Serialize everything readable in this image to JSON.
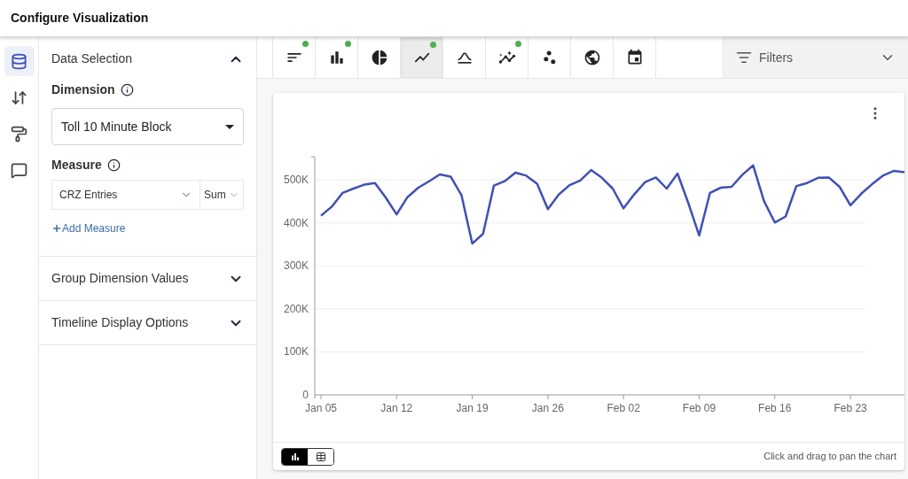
{
  "header": {
    "title": "Configure Visualization"
  },
  "rail": [
    {
      "kind": "data",
      "selected": true
    },
    {
      "kind": "sort",
      "selected": false
    },
    {
      "kind": "format",
      "selected": false
    },
    {
      "kind": "annotate",
      "selected": false
    }
  ],
  "panel": {
    "sections": [
      {
        "title": "Data Selection",
        "expanded": true,
        "dimension": {
          "label": "Dimension",
          "value": "Toll 10 Minute Block"
        },
        "measure": {
          "label": "Measure",
          "field": "CRZ Entries",
          "aggregate": "Sum"
        },
        "add_link": "Add Measure"
      },
      {
        "title": "Group Dimension Values",
        "expanded": false
      },
      {
        "title": "Timeline Display Options",
        "expanded": false
      }
    ]
  },
  "toolbar": {
    "chart_types": [
      {
        "kind": "bar-horizontal",
        "selected": false,
        "has_data": true
      },
      {
        "kind": "column",
        "selected": false,
        "has_data": true
      },
      {
        "kind": "pie",
        "selected": false,
        "has_data": false
      },
      {
        "kind": "line",
        "selected": true,
        "has_data": true
      },
      {
        "kind": "curve",
        "selected": false,
        "has_data": false
      },
      {
        "kind": "combo",
        "selected": false,
        "has_data": true
      },
      {
        "kind": "scatter",
        "selected": false,
        "has_data": false
      },
      {
        "kind": "map",
        "selected": false,
        "has_data": false
      },
      {
        "kind": "calendar",
        "selected": false,
        "has_data": false
      }
    ],
    "filters": {
      "label": "Filters"
    }
  },
  "chart_card": {
    "chart_data": {
      "type": "line",
      "categories": [
        "Jan 05",
        null,
        null,
        null,
        null,
        null,
        null,
        "Jan 12",
        null,
        null,
        null,
        null,
        null,
        null,
        "Jan 19",
        null,
        null,
        null,
        null,
        null,
        null,
        "Jan 26",
        null,
        null,
        null,
        null,
        null,
        null,
        "Feb 02",
        null,
        null,
        null,
        null,
        null,
        null,
        "Feb 09",
        null,
        null,
        null,
        null,
        null,
        null,
        "Feb 16",
        null,
        null,
        null,
        null,
        null,
        null,
        "Feb 23",
        null,
        null,
        null,
        null,
        null
      ],
      "series": [
        {
          "color": "#3f51b5",
          "values": [
            417000,
            438000,
            470000,
            480000,
            489000,
            493000,
            459000,
            420000,
            460000,
            482000,
            497000,
            513000,
            508000,
            465000,
            352000,
            375000,
            487000,
            497000,
            517000,
            510000,
            491000,
            432000,
            466000,
            488000,
            499000,
            523000,
            505000,
            480000,
            434000,
            467000,
            495000,
            506000,
            480000,
            515000,
            446000,
            371000,
            470000,
            482000,
            484000,
            512000,
            534000,
            451000,
            401000,
            415000,
            486000,
            493000,
            505000,
            506000,
            484000,
            441000,
            468000,
            490000,
            510000,
            521000,
            518000
          ]
        }
      ],
      "grid": true,
      "ylim": [
        0,
        550000
      ],
      "yticks": [
        {
          "value": 0,
          "label": "0"
        },
        {
          "value": 100000,
          "label": "100K"
        },
        {
          "value": 200000,
          "label": "200K"
        },
        {
          "value": 300000,
          "label": "300K"
        },
        {
          "value": 400000,
          "label": "400K"
        },
        {
          "value": 500000,
          "label": "500K"
        }
      ]
    },
    "views": [
      {
        "kind": "chart",
        "selected": true
      },
      {
        "kind": "table",
        "selected": false
      }
    ],
    "hint": "Click and drag to pan the chart"
  }
}
